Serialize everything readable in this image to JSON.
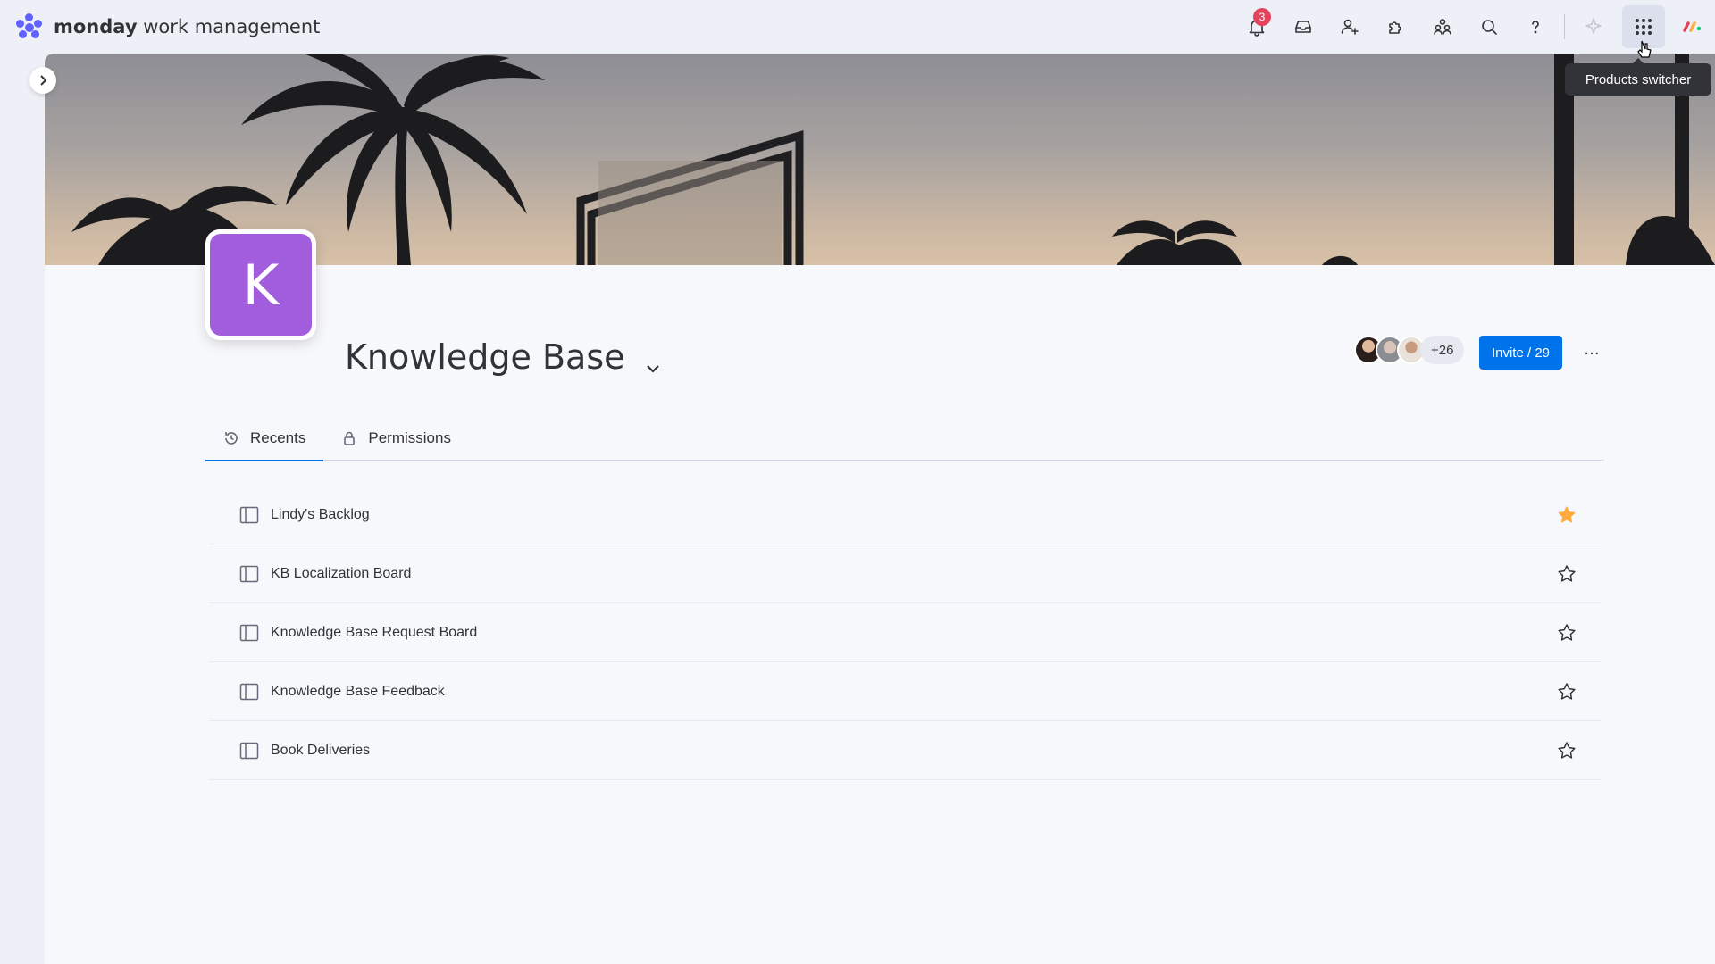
{
  "app": {
    "brand_bold": "monday",
    "brand_rest": "work management"
  },
  "topbar": {
    "notifications_count": "3",
    "icons": [
      "bell-icon",
      "inbox-icon",
      "invite-members-icon",
      "apps-icon",
      "search-people-icon",
      "search-icon",
      "help-icon",
      "ai-sparkle-icon",
      "products-switcher-icon",
      "monday-logo-icon"
    ],
    "tooltip": "Products switcher"
  },
  "workspace": {
    "avatar_letter": "K",
    "avatar_color": "#a25ddc",
    "title": "Knowledge Base",
    "members_more": "+26",
    "invite_label": "Invite / 29",
    "more_label": "···"
  },
  "tabs": [
    {
      "label": "Recents",
      "icon": "history-icon",
      "active": true
    },
    {
      "label": "Permissions",
      "icon": "lock-icon",
      "active": false
    }
  ],
  "recents": [
    {
      "label": "Lindy's Backlog",
      "starred": true
    },
    {
      "label": "KB Localization Board",
      "starred": false
    },
    {
      "label": "Knowledge Base Request Board",
      "starred": false
    },
    {
      "label": "Knowledge Base Feedback",
      "starred": false
    },
    {
      "label": "Book Deliveries",
      "starred": false
    }
  ],
  "colors": {
    "accent": "#0073ea",
    "star_filled": "#fdab3d",
    "badge": "#e2445c"
  }
}
